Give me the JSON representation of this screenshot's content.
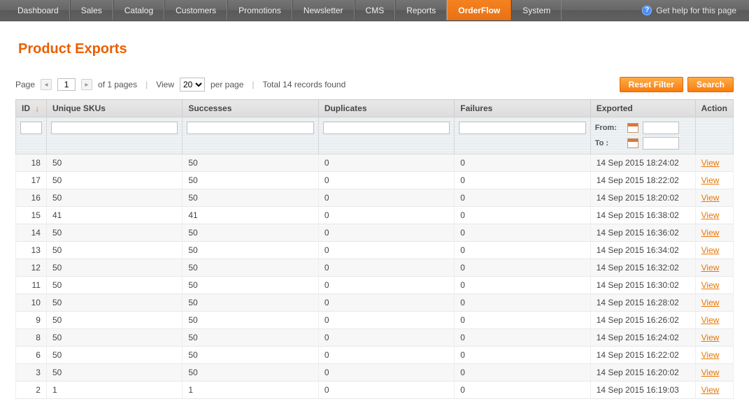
{
  "nav": {
    "items": [
      {
        "label": "Dashboard",
        "active": false
      },
      {
        "label": "Sales",
        "active": false
      },
      {
        "label": "Catalog",
        "active": false
      },
      {
        "label": "Customers",
        "active": false
      },
      {
        "label": "Promotions",
        "active": false
      },
      {
        "label": "Newsletter",
        "active": false
      },
      {
        "label": "CMS",
        "active": false
      },
      {
        "label": "Reports",
        "active": false
      },
      {
        "label": "OrderFlow",
        "active": true
      },
      {
        "label": "System",
        "active": false
      }
    ],
    "help_label": "Get help for this page"
  },
  "page": {
    "title": "Product Exports"
  },
  "toolbar": {
    "page_label": "Page",
    "page_value": "1",
    "of_pages_label": "of 1 pages",
    "view_label": "View",
    "per_page_value": "20",
    "per_page_label": "per page",
    "total_label": "Total 14 records found",
    "reset_filter_label": "Reset Filter",
    "search_label": "Search"
  },
  "grid": {
    "columns": {
      "id": "ID",
      "sku": "Unique SKUs",
      "succ": "Successes",
      "dup": "Duplicates",
      "fail": "Failures",
      "exp": "Exported",
      "act": "Action"
    },
    "sort_indicator": "↓",
    "filter": {
      "from_label": "From:",
      "to_label": "To :"
    },
    "action_link_label": "View",
    "rows": [
      {
        "id": "18",
        "sku": "50",
        "succ": "50",
        "dup": "0",
        "fail": "0",
        "exp": "14 Sep 2015 18:24:02"
      },
      {
        "id": "17",
        "sku": "50",
        "succ": "50",
        "dup": "0",
        "fail": "0",
        "exp": "14 Sep 2015 18:22:02"
      },
      {
        "id": "16",
        "sku": "50",
        "succ": "50",
        "dup": "0",
        "fail": "0",
        "exp": "14 Sep 2015 18:20:02"
      },
      {
        "id": "15",
        "sku": "41",
        "succ": "41",
        "dup": "0",
        "fail": "0",
        "exp": "14 Sep 2015 16:38:02"
      },
      {
        "id": "14",
        "sku": "50",
        "succ": "50",
        "dup": "0",
        "fail": "0",
        "exp": "14 Sep 2015 16:36:02"
      },
      {
        "id": "13",
        "sku": "50",
        "succ": "50",
        "dup": "0",
        "fail": "0",
        "exp": "14 Sep 2015 16:34:02"
      },
      {
        "id": "12",
        "sku": "50",
        "succ": "50",
        "dup": "0",
        "fail": "0",
        "exp": "14 Sep 2015 16:32:02"
      },
      {
        "id": "11",
        "sku": "50",
        "succ": "50",
        "dup": "0",
        "fail": "0",
        "exp": "14 Sep 2015 16:30:02"
      },
      {
        "id": "10",
        "sku": "50",
        "succ": "50",
        "dup": "0",
        "fail": "0",
        "exp": "14 Sep 2015 16:28:02"
      },
      {
        "id": "9",
        "sku": "50",
        "succ": "50",
        "dup": "0",
        "fail": "0",
        "exp": "14 Sep 2015 16:26:02"
      },
      {
        "id": "8",
        "sku": "50",
        "succ": "50",
        "dup": "0",
        "fail": "0",
        "exp": "14 Sep 2015 16:24:02"
      },
      {
        "id": "6",
        "sku": "50",
        "succ": "50",
        "dup": "0",
        "fail": "0",
        "exp": "14 Sep 2015 16:22:02"
      },
      {
        "id": "3",
        "sku": "50",
        "succ": "50",
        "dup": "0",
        "fail": "0",
        "exp": "14 Sep 2015 16:20:02"
      },
      {
        "id": "2",
        "sku": "1",
        "succ": "1",
        "dup": "0",
        "fail": "0",
        "exp": "14 Sep 2015 16:19:03"
      }
    ]
  }
}
